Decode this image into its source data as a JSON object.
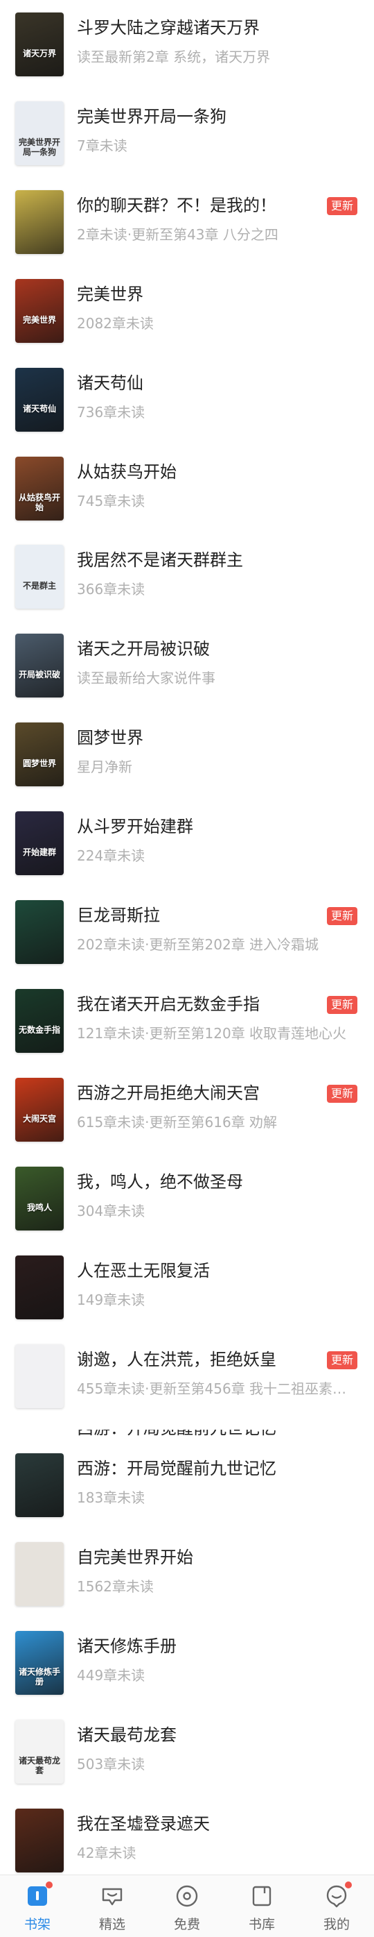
{
  "books": [
    {
      "title": "斗罗大陆之穿越诸天万界",
      "meta": "读至最新第2章 系统，诸天万界",
      "badge": "",
      "cover": "#3a3528",
      "cover_text": "诸天万界"
    },
    {
      "title": "完美世界开局一条狗",
      "meta": "7章未读",
      "badge": "",
      "cover": "#e8ecf2",
      "cover_text": "完美世界开局一条狗"
    },
    {
      "title": "你的聊天群？不！是我的！",
      "meta": "2章未读·更新至第43章 八分之四",
      "badge": "更新",
      "cover": "#c9b24a",
      "cover_text": ""
    },
    {
      "title": "完美世界",
      "meta": "2082章未读",
      "badge": "",
      "cover": "#a8361f",
      "cover_text": "完美世界"
    },
    {
      "title": "诸天苟仙",
      "meta": "736章未读",
      "badge": "",
      "cover": "#1d3348",
      "cover_text": "诸天苟仙"
    },
    {
      "title": "从姑获鸟开始",
      "meta": "745章未读",
      "badge": "",
      "cover": "#8a4a2a",
      "cover_text": "从姑获鸟开始"
    },
    {
      "title": "我居然不是诸天群群主",
      "meta": "366章未读",
      "badge": "",
      "cover": "#e9eef4",
      "cover_text": "不是群主"
    },
    {
      "title": "诸天之开局被识破",
      "meta": "读至最新给大家说件事",
      "badge": "",
      "cover": "#4b5b6b",
      "cover_text": "开局被识破"
    },
    {
      "title": "圆梦世界",
      "meta": "星月净新",
      "badge": "",
      "cover": "#5a4a2a",
      "cover_text": "圆梦世界"
    },
    {
      "title": "从斗罗开始建群",
      "meta": "224章未读",
      "badge": "",
      "cover": "#2a2840",
      "cover_text": "开始建群"
    },
    {
      "title": "巨龙哥斯拉",
      "meta": "202章未读·更新至第202章 进入冷霜城",
      "badge": "更新",
      "cover": "#1e4a3a",
      "cover_text": ""
    },
    {
      "title": "我在诸天开启无数金手指",
      "meta": "121章未读·更新至第120章 收取青莲地心火",
      "badge": "更新",
      "cover": "#1a3a2a",
      "cover_text": "无数金手指"
    },
    {
      "title": "西游之开局拒绝大闹天宫",
      "meta": "615章未读·更新至第616章 劝解",
      "badge": "更新",
      "cover": "#c83a1a",
      "cover_text": "大闹天宫"
    },
    {
      "title": "我，鸣人，绝不做圣母",
      "meta": "304章未读",
      "badge": "",
      "cover": "#3a5a2a",
      "cover_text": "我鸣人"
    },
    {
      "title": "人在恶土无限复活",
      "meta": "149章未读",
      "badge": "",
      "cover": "#2a1c1c",
      "cover_text": ""
    },
    {
      "title": "谢邀，人在洪荒，拒绝妖皇",
      "meta": "455章未读·更新至第456章 我十二祖巫素…",
      "badge": "更新",
      "cover": "#f1f1f3",
      "cover_text": ""
    },
    {
      "title": "西游：开局觉醒前九世记忆",
      "meta": "183章未读",
      "badge": "",
      "cover": "#2a3a3a",
      "cover_text": ""
    },
    {
      "title": "自完美世界开始",
      "meta": "1562章未读",
      "badge": "",
      "cover": "#e6e2dc",
      "cover_text": ""
    },
    {
      "title": "诸天修炼手册",
      "meta": "449章未读",
      "badge": "",
      "cover": "#2f8fd0",
      "cover_text": "诸天修炼手册"
    },
    {
      "title": "诸天最苟龙套",
      "meta": "503章未读",
      "badge": "",
      "cover": "#f3f3f3",
      "cover_text": "诸天最苟龙套"
    },
    {
      "title": "我在圣墟登录遮天",
      "meta": "42章未读",
      "badge": "",
      "cover": "#5a2a1a",
      "cover_text": ""
    }
  ],
  "partial_title": "西游：开局觉醒前九世记忆",
  "tabs": [
    {
      "label": "书架",
      "icon": "bookshelf-icon",
      "active": true,
      "dot": false
    },
    {
      "label": "精选",
      "icon": "featured-icon",
      "active": false,
      "dot": false
    },
    {
      "label": "免费",
      "icon": "free-icon",
      "active": false,
      "dot": false
    },
    {
      "label": "书库",
      "icon": "library-icon",
      "active": false,
      "dot": false
    },
    {
      "label": "我的",
      "icon": "profile-icon",
      "active": false,
      "dot": true
    }
  ],
  "colors": {
    "accent": "#2a8ae6",
    "badge": "#f0544b"
  }
}
